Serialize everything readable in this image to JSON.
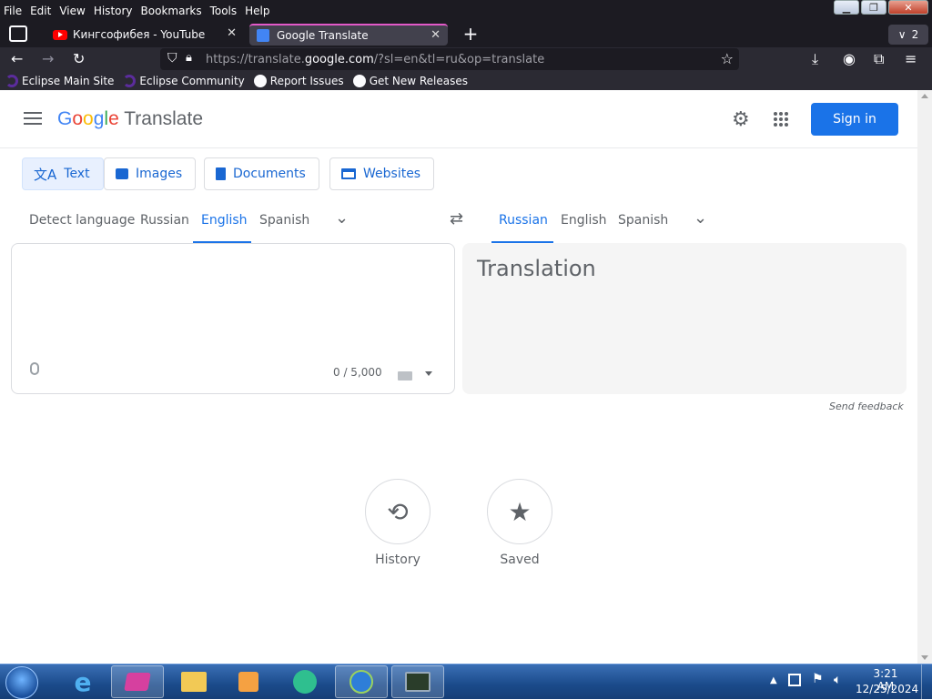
{
  "browser": {
    "menu": [
      "File",
      "Edit",
      "View",
      "History",
      "Bookmarks",
      "Tools",
      "Help"
    ],
    "tabs": [
      {
        "title": "Кингсофибея - YouTube",
        "active": false
      },
      {
        "title": "Google Translate",
        "active": true
      }
    ],
    "tab_count": "2",
    "url_prefix": "https://translate.",
    "url_domain": "google.com",
    "url_suffix": "/?sl=en&tl=ru&op=translate",
    "bookmarks": [
      "Eclipse Main Site",
      "Eclipse Community",
      "Report Issues",
      "Get New Releases"
    ]
  },
  "translate": {
    "logo_google": "Google",
    "logo_product": "Translate",
    "sign_in": "Sign in",
    "modes": [
      "Text",
      "Images",
      "Documents",
      "Websites"
    ],
    "source_langs": [
      "Detect language",
      "Russian",
      "English",
      "Spanish"
    ],
    "source_selected": "English",
    "target_langs": [
      "Russian",
      "English",
      "Spanish"
    ],
    "target_selected": "Russian",
    "char_count": "0 / 5,000",
    "translation_placeholder": "Translation",
    "send_feedback": "Send feedback",
    "history_label": "History",
    "saved_label": "Saved"
  },
  "taskbar": {
    "time": "3:21 AM",
    "date": "12/25/2024"
  },
  "colors": {
    "accent": "#1a73e8",
    "signin_bg": "#1a73e8",
    "tab_highlight": "#e259c8"
  }
}
